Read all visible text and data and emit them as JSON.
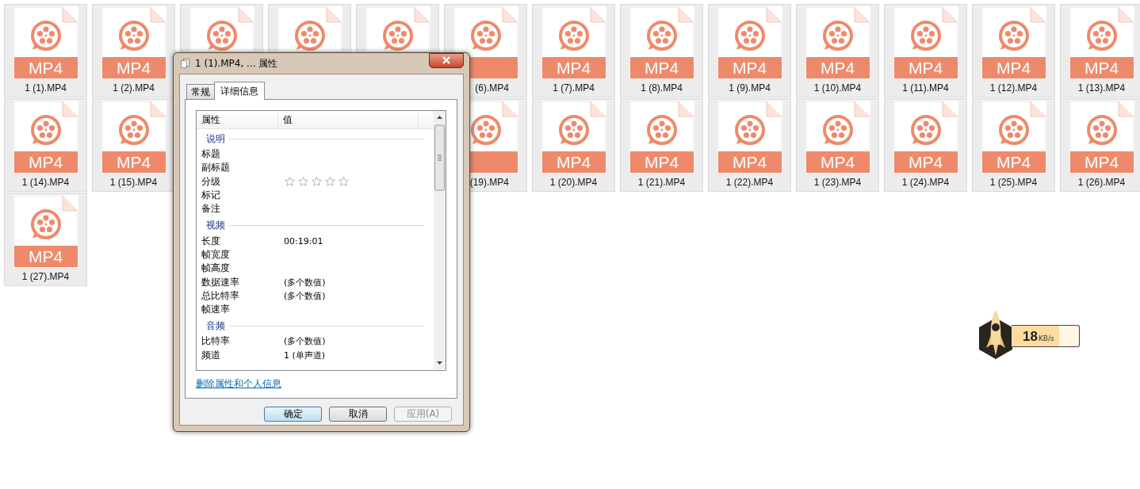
{
  "files": [
    {
      "kind": "full",
      "label": "1 (1).MP4",
      "badge": "MP4",
      "selected": true
    },
    {
      "kind": "full",
      "label": "1 (2).MP4",
      "badge": "MP4",
      "selected": true
    },
    {
      "kind": "top",
      "selected": true
    },
    {
      "kind": "top",
      "selected": true
    },
    {
      "kind": "top",
      "selected": true
    },
    {
      "kind": "tail",
      "label": "(6).MP4",
      "selected": true
    },
    {
      "kind": "full",
      "label": "1 (7).MP4",
      "badge": "MP4",
      "selected": true
    },
    {
      "kind": "full",
      "label": "1 (8).MP4",
      "badge": "MP4",
      "selected": true
    },
    {
      "kind": "full",
      "label": "1 (9).MP4",
      "badge": "MP4",
      "selected": true
    },
    {
      "kind": "full",
      "label": "1 (10).MP4",
      "badge": "MP4",
      "selected": true
    },
    {
      "kind": "full",
      "label": "1 (11).MP4",
      "badge": "MP4",
      "selected": true
    },
    {
      "kind": "full",
      "label": "1 (12).MP4",
      "badge": "MP4",
      "selected": true
    },
    {
      "kind": "full",
      "label": "1 (13).MP4",
      "badge": "MP4",
      "selected": true
    },
    {
      "kind": "full",
      "label": "1 (14).MP4",
      "badge": "MP4",
      "selected": true
    },
    {
      "kind": "full",
      "label": "1 (15).MP4",
      "badge": "MP4",
      "selected": true
    },
    {
      "kind": "hidden"
    },
    {
      "kind": "hidden"
    },
    {
      "kind": "hidden"
    },
    {
      "kind": "tail",
      "label": "(19).MP4",
      "selected": true
    },
    {
      "kind": "full",
      "label": "1 (20).MP4",
      "badge": "MP4",
      "selected": true
    },
    {
      "kind": "full",
      "label": "1 (21).MP4",
      "badge": "MP4",
      "selected": true
    },
    {
      "kind": "full",
      "label": "1 (22).MP4",
      "badge": "MP4",
      "selected": true
    },
    {
      "kind": "full",
      "label": "1 (23).MP4",
      "badge": "MP4",
      "selected": true
    },
    {
      "kind": "full",
      "label": "1 (24).MP4",
      "badge": "MP4",
      "selected": true
    },
    {
      "kind": "full",
      "label": "1 (25).MP4",
      "badge": "MP4",
      "selected": true
    },
    {
      "kind": "full",
      "label": "1 (26).MP4",
      "badge": "MP4",
      "selected": true
    },
    {
      "kind": "full",
      "label": "1 (27).MP4",
      "badge": "MP4",
      "selected": true
    }
  ],
  "dialog": {
    "title": "1 (1).MP4, ... 属性",
    "tabs": [
      {
        "label": "常规",
        "selected": false
      },
      {
        "label": "详细信息",
        "selected": true
      }
    ],
    "columns": [
      "属性",
      "值"
    ],
    "groups": [
      {
        "title": "说明",
        "rows": [
          {
            "kind": "text",
            "name": "标题"
          },
          {
            "kind": "text",
            "name": "副标题"
          },
          {
            "kind": "rating",
            "name": "分级",
            "stars": 0
          },
          {
            "kind": "text",
            "name": "标记"
          },
          {
            "kind": "text",
            "name": "备注"
          }
        ]
      },
      {
        "title": "视频",
        "rows": [
          {
            "kind": "text",
            "name": "长度",
            "value": "00:19:01"
          },
          {
            "kind": "text",
            "name": "帧宽度"
          },
          {
            "kind": "text",
            "name": "帧高度"
          },
          {
            "kind": "text",
            "name": "数据速率",
            "value": "(多个数值)"
          },
          {
            "kind": "text",
            "name": "总比特率",
            "value": "(多个数值)"
          },
          {
            "kind": "text",
            "name": "帧速率"
          }
        ]
      },
      {
        "title": "音频",
        "rows": [
          {
            "kind": "text",
            "name": "比特率",
            "value": "(多个数值)"
          },
          {
            "kind": "text",
            "name": "频道",
            "value": "1 (单声道)"
          }
        ]
      }
    ],
    "link": "删除属性和个人信息",
    "buttons": [
      {
        "label": "确定",
        "default": true,
        "disabled": false
      },
      {
        "label": "取消",
        "default": false,
        "disabled": false
      },
      {
        "label": "应用(A)",
        "default": false,
        "disabled": true
      }
    ]
  },
  "speed_widget": {
    "value": "18",
    "unit": "KB/s",
    "level": 0.7
  }
}
